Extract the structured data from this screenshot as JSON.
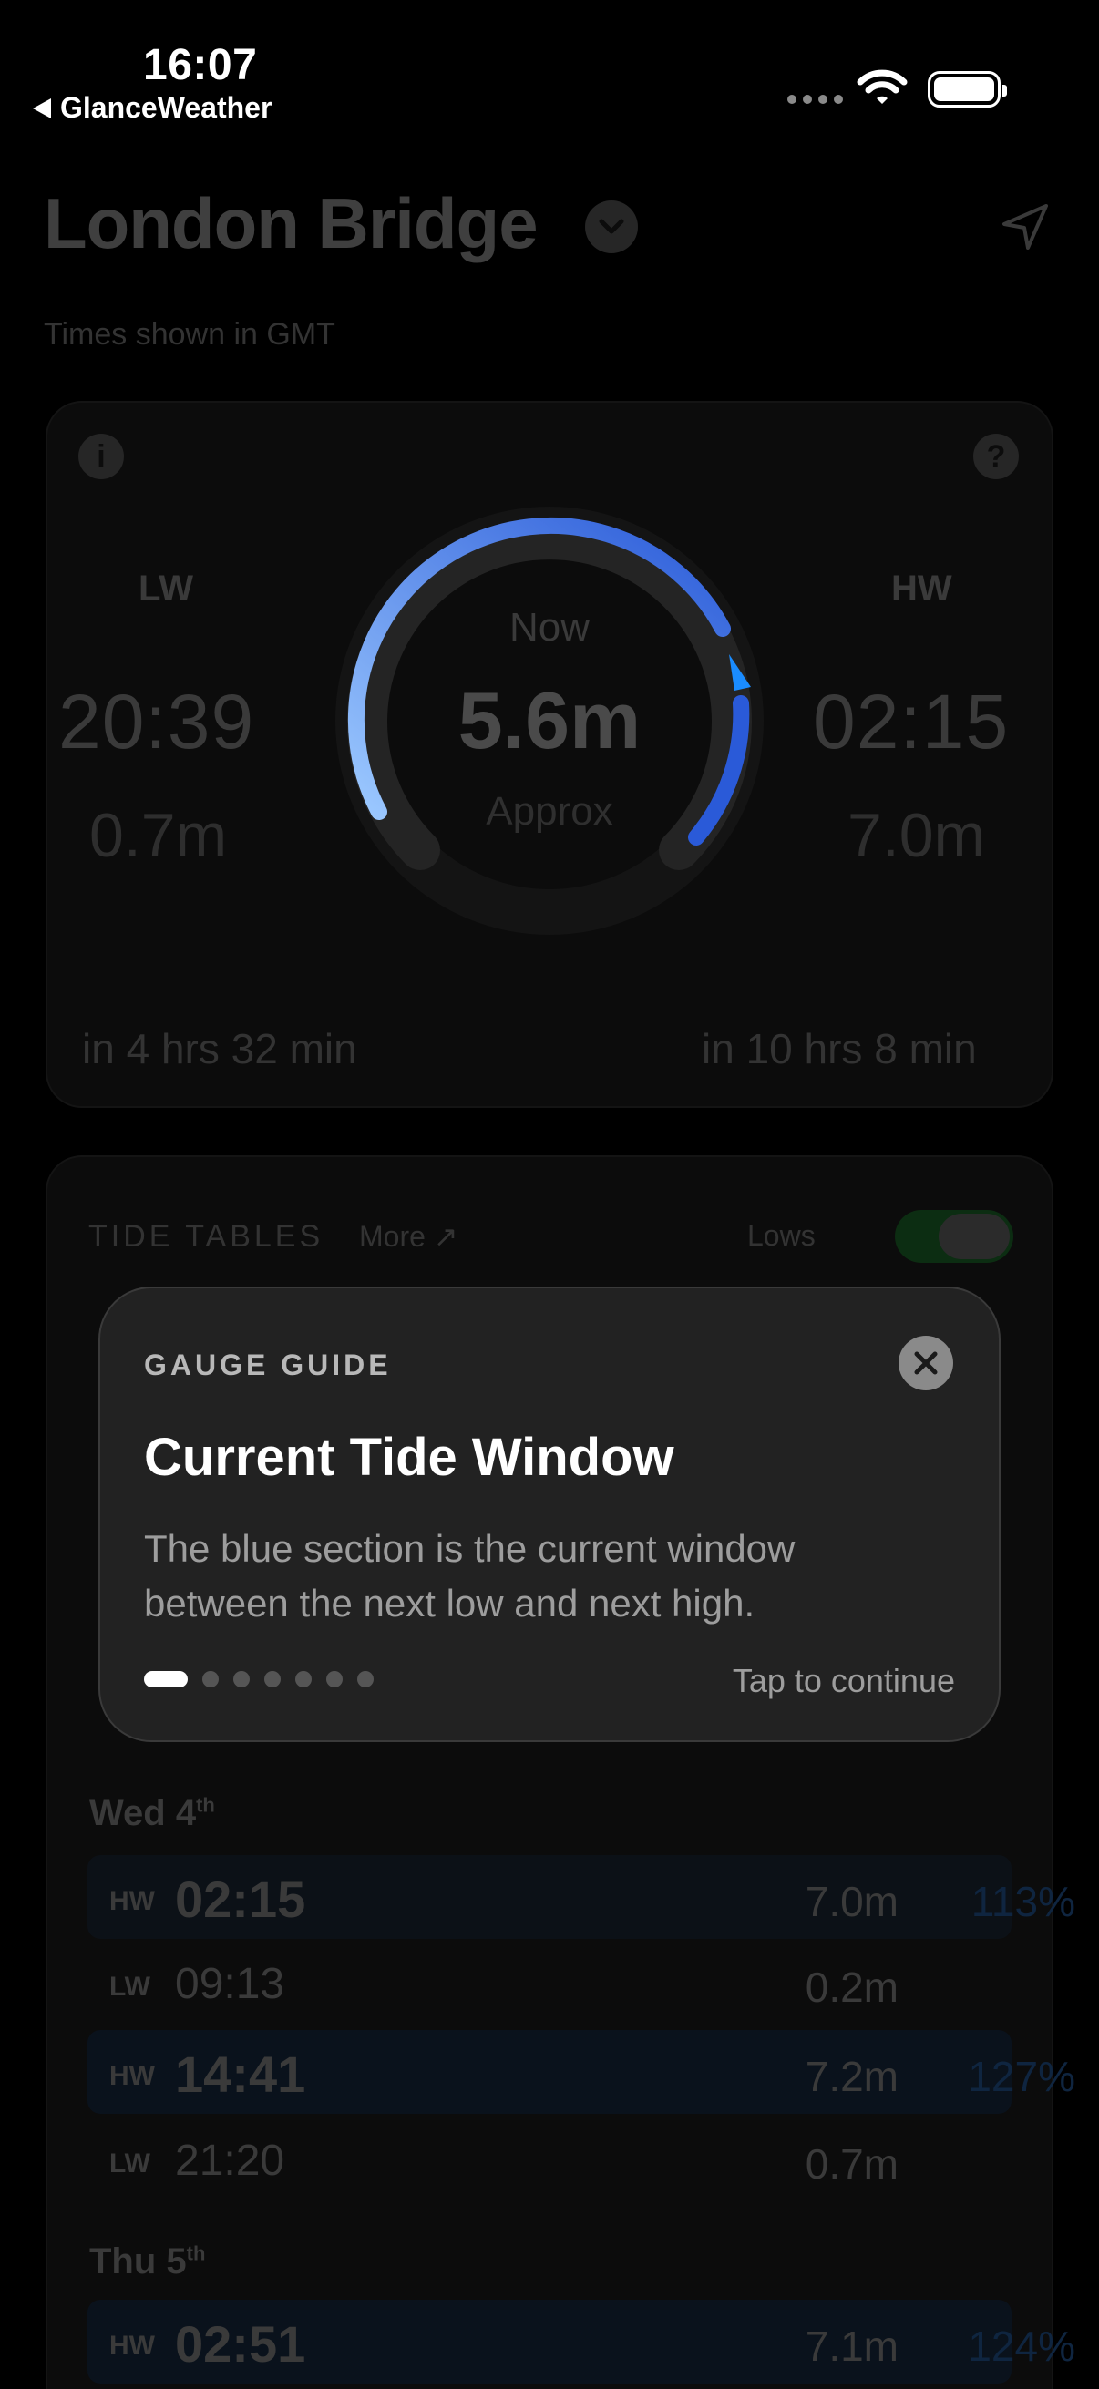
{
  "status_bar": {
    "time": "16:07",
    "back_app": "GlanceWeather"
  },
  "header": {
    "title": "London Bridge",
    "timezone_note": "Times shown in GMT"
  },
  "gauge_card": {
    "low": {
      "label": "LW",
      "time": "20:39",
      "height": "0.7m",
      "eta": "in 4 hrs 32 min"
    },
    "high": {
      "label": "HW",
      "time": "02:15",
      "height": "7.0m",
      "eta": "in 10 hrs 8 min"
    },
    "center": {
      "caption": "Now",
      "value": "5.6m",
      "note": "Approx"
    },
    "info_icon": "info-icon",
    "help_icon": "question-icon",
    "colors": {
      "arc_start": "#9cc9ff",
      "arc_end": "#2a5ad8",
      "pointer": "#1a8cff"
    }
  },
  "tide_tables": {
    "heading": "TIDE TABLES",
    "more_label": "More ↗",
    "lows_label": "Lows",
    "days": [
      {
        "day": "Wed 4",
        "suffix": "th",
        "rows": [
          {
            "kind": "HW",
            "time": "02:15",
            "height": "7.0m",
            "pct": "113%"
          },
          {
            "kind": "LW",
            "time": "09:13",
            "height": "0.2m",
            "pct": ""
          },
          {
            "kind": "HW",
            "time": "14:41",
            "height": "7.2m",
            "pct": "127%"
          },
          {
            "kind": "LW",
            "time": "21:20",
            "height": "0.7m",
            "pct": ""
          }
        ]
      },
      {
        "day": "Thu 5",
        "suffix": "th",
        "rows": [
          {
            "kind": "HW",
            "time": "02:51",
            "height": "7.1m",
            "pct": "124%"
          }
        ]
      }
    ]
  },
  "guide": {
    "kicker": "GAUGE GUIDE",
    "title": "Current Tide Window",
    "body": "The blue section is the current window between the next low and next high.",
    "continue_label": "Tap to continue",
    "page_index": 1,
    "page_count": 7
  }
}
